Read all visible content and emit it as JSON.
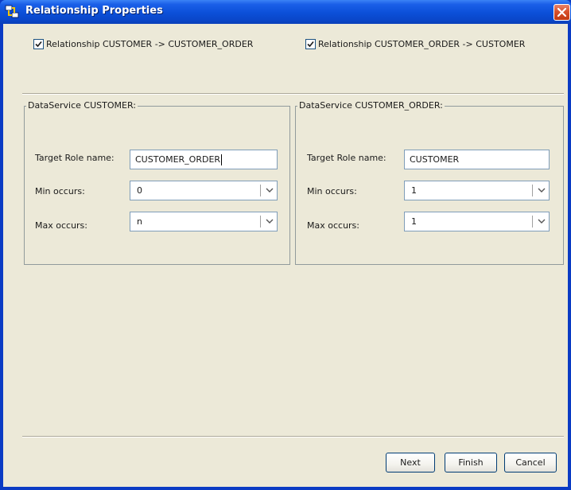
{
  "window": {
    "title": "Relationship Properties",
    "icon": "relationship-app-icon",
    "close_icon": "close-icon"
  },
  "relationships": [
    {
      "label": "Relationship CUSTOMER -> CUSTOMER_ORDER",
      "checked": true
    },
    {
      "label": "Relationship CUSTOMER_ORDER -> CUSTOMER",
      "checked": true
    }
  ],
  "panels": [
    {
      "title": "DataService CUSTOMER:",
      "target_role_label": "Target Role name:",
      "target_role_value": "CUSTOMER_ORDER",
      "min_label": "Min occurs:",
      "min_value": "0",
      "max_label": "Max occurs:",
      "max_value": "n"
    },
    {
      "title": "DataService CUSTOMER_ORDER:",
      "target_role_label": "Target Role name:",
      "target_role_value": "CUSTOMER",
      "min_label": "Min occurs:",
      "min_value": "1",
      "max_label": "Max occurs:",
      "max_value": "1"
    }
  ],
  "buttons": {
    "next": "Next",
    "finish": "Finish",
    "cancel": "Cancel"
  },
  "colors": {
    "titlebar": "#0a46c8",
    "dialog_background": "#ece9d8",
    "close_button": "#d8512c",
    "field_border": "#7f9db9"
  }
}
